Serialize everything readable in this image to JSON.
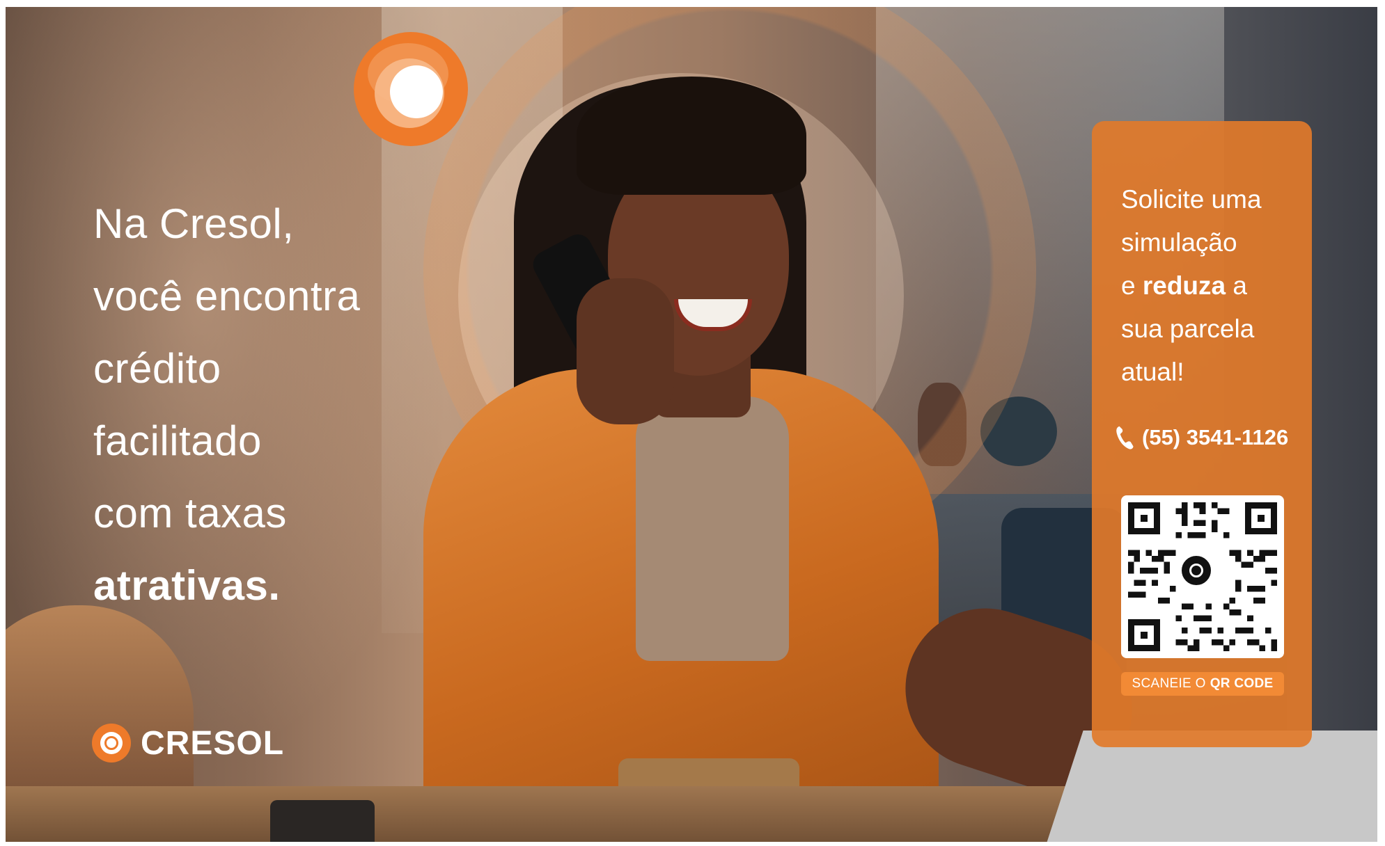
{
  "headline": {
    "lines": [
      "Na Cresol,",
      "você encontra",
      "crédito",
      "facilitado",
      "com taxas",
      "atrativas."
    ]
  },
  "brand": {
    "name": "CRESOL"
  },
  "panel": {
    "cta_line1": "Solicite uma",
    "cta_line2": "simulação",
    "cta_line3_pre": "e ",
    "cta_line3_bold": "reduza",
    "cta_line3_post": " a",
    "cta_line4": "sua parcela",
    "cta_line5": "atual!",
    "phone": "(55) 3541-1126",
    "scan_pre": "SCANEIE O",
    "scan_bold": "QR CODE"
  },
  "icons": [
    "cresol-logo-icon",
    "phone-icon",
    "qr-code-icon"
  ],
  "colors": {
    "brand_orange": "#ee7a2a",
    "panel_orange": "#e17a2a",
    "white": "#ffffff"
  }
}
